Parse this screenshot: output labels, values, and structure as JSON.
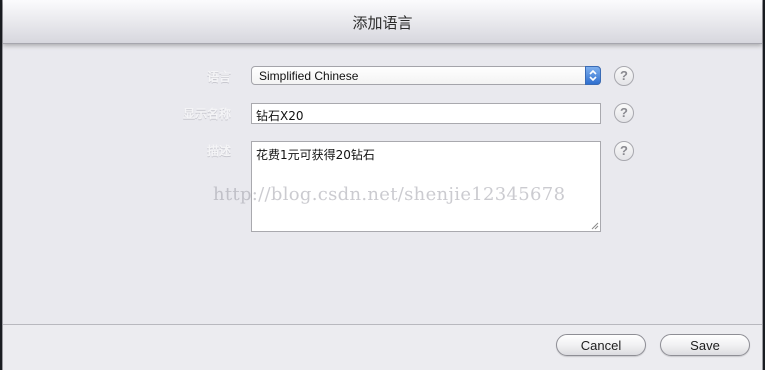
{
  "dialog": {
    "title": "添加语言",
    "fields": {
      "language": {
        "label": "语言",
        "value": "Simplified Chinese"
      },
      "display_name": {
        "label": "显示名称",
        "value": "钻石X20"
      },
      "description": {
        "label": "描述",
        "value": "花费1元可获得20钻石"
      }
    },
    "help_glyph": "?",
    "watermark": "http://blog.csdn.net/shenjie12345678",
    "buttons": {
      "cancel": "Cancel",
      "save": "Save"
    }
  }
}
